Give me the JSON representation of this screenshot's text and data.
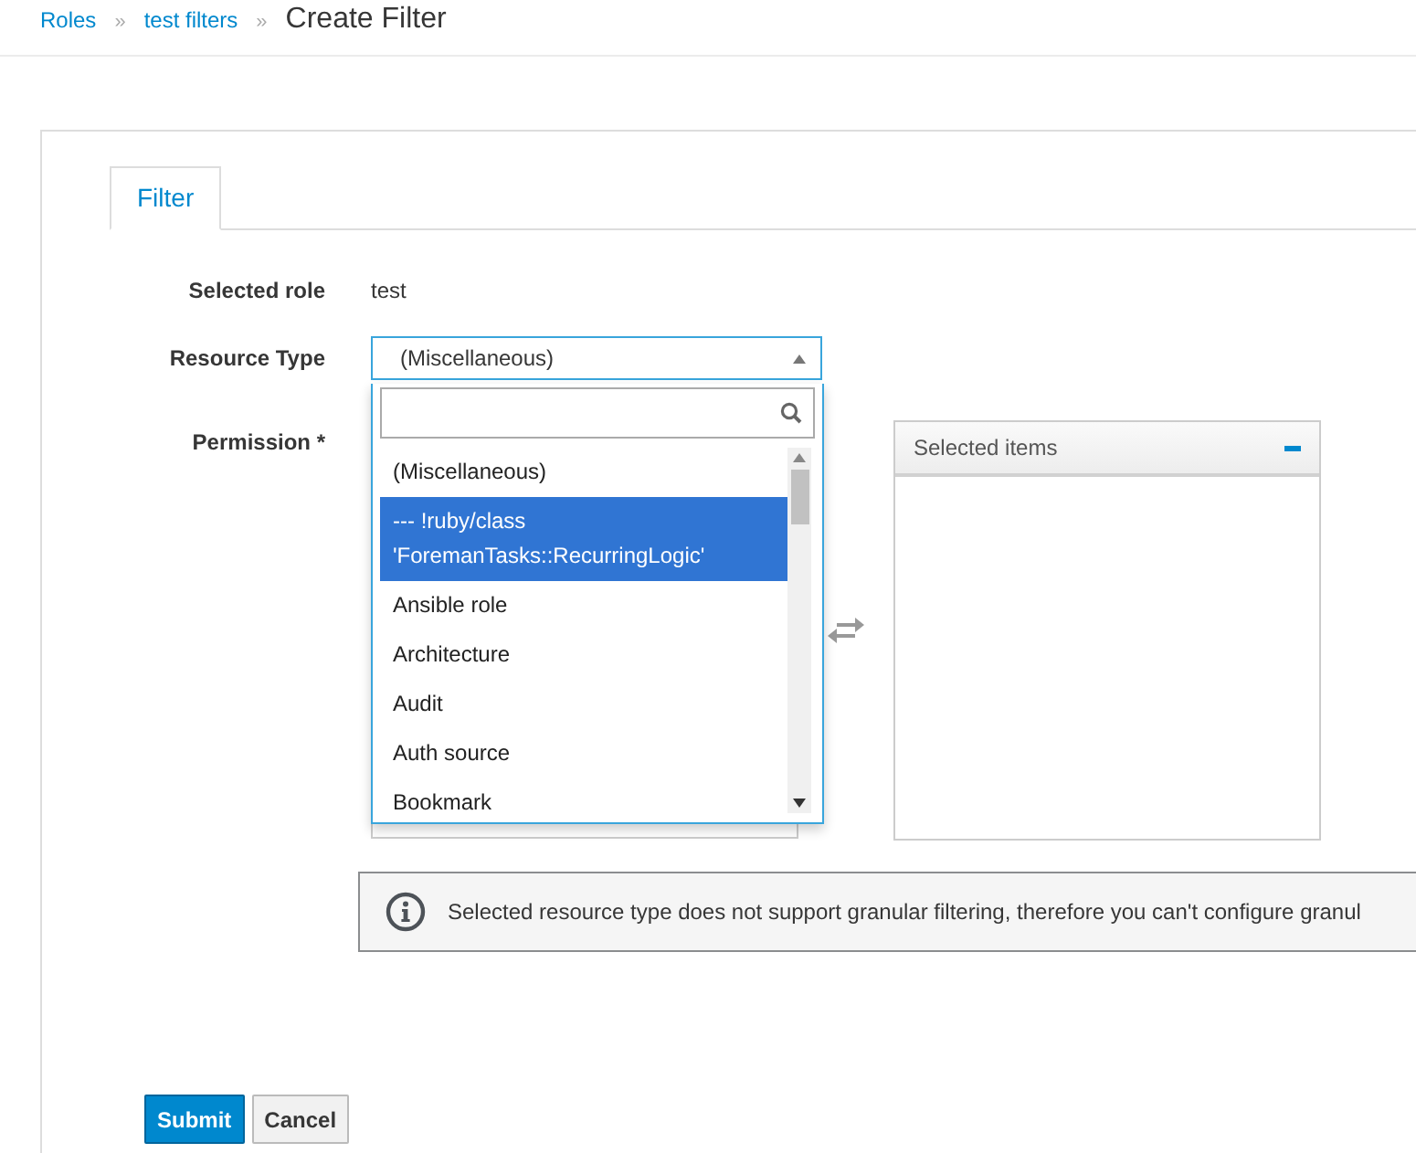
{
  "breadcrumb": [
    {
      "label": "Roles",
      "kind": "link"
    },
    {
      "label": "»",
      "kind": "separator"
    },
    {
      "label": "test filters",
      "kind": "link"
    },
    {
      "label": "»",
      "kind": "separator"
    },
    {
      "label": "Create Filter",
      "kind": "current"
    }
  ],
  "tabs": [
    {
      "label": "Filter",
      "selected": true
    }
  ],
  "selected_role": {
    "label": "Selected role",
    "value": "test"
  },
  "resource_type": {
    "label": "Resource Type",
    "value": "(Miscellaneous)",
    "expanded": true,
    "options": [
      {
        "label": "(Miscellaneous)",
        "highlighted": false
      },
      {
        "label": "--- !ruby/class 'ForemanTasks::RecurringLogic'",
        "highlighted": true
      },
      {
        "label": "Ansible role",
        "highlighted": false
      },
      {
        "label": "Architecture",
        "highlighted": false
      },
      {
        "label": "Audit",
        "highlighted": false
      },
      {
        "label": "Auth source",
        "highlighted": false
      },
      {
        "label": "Bookmark",
        "highlighted": false
      }
    ]
  },
  "permission": {
    "label": "Permission *",
    "selected_items_title": "Selected items"
  },
  "alert": {
    "text": "Selected resource type does not support granular filtering, therefore you can't configure granul"
  },
  "buttons": [
    {
      "label": "Submit",
      "kind": "primary"
    },
    {
      "label": "Cancel",
      "kind": "default"
    }
  ]
}
